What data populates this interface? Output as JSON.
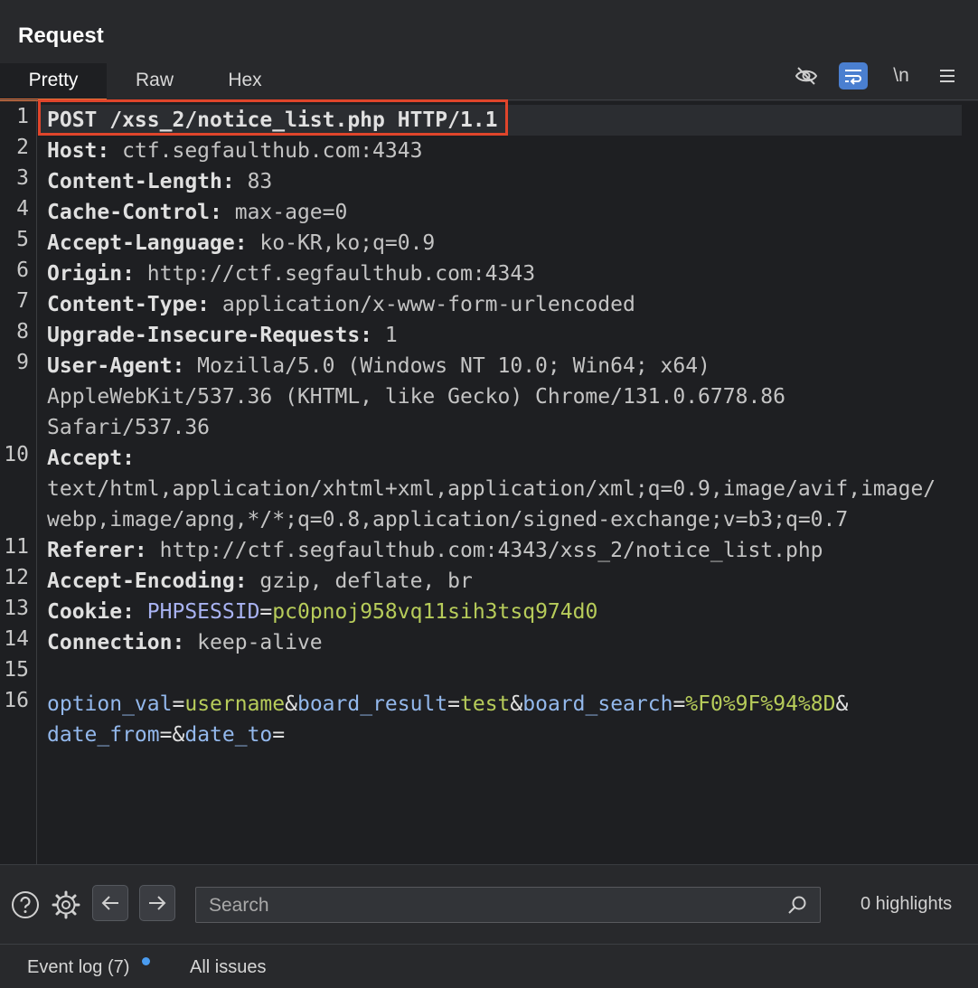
{
  "panel": {
    "title": "Request"
  },
  "tabs": [
    {
      "label": "Pretty",
      "active": true
    },
    {
      "label": "Raw",
      "active": false
    },
    {
      "label": "Hex",
      "active": false
    }
  ],
  "toolbar": {
    "icons": [
      "eye-slash-icon",
      "wrap-lines-icon",
      "newline-icon",
      "menu-icon"
    ],
    "newline_label": "\\n"
  },
  "editor": {
    "line_numbers": [
      "1",
      "2",
      "3",
      "4",
      "5",
      "6",
      "7",
      "8",
      "9",
      "10",
      "11",
      "12",
      "13",
      "14",
      "15",
      "16"
    ],
    "request_line": "POST /xss_2/notice_list.php HTTP/1.1",
    "headers": [
      {
        "name": "Host:",
        "value": " ctf.segfaulthub.com:4343"
      },
      {
        "name": "Content-Length:",
        "value": " 83"
      },
      {
        "name": "Cache-Control:",
        "value": " max-age=0"
      },
      {
        "name": "Accept-Language:",
        "value": " ko-KR,ko;q=0.9"
      },
      {
        "name": "Origin:",
        "value": " http://ctf.segfaulthub.com:4343"
      },
      {
        "name": "Content-Type:",
        "value": " application/x-www-form-urlencoded"
      },
      {
        "name": "Upgrade-Insecure-Requests:",
        "value": " 1"
      },
      {
        "name": "User-Agent:",
        "value": " Mozilla/5.0 (Windows NT 10.0; Win64; x64)"
      },
      {
        "name": "Accept:",
        "value": ""
      },
      {
        "name": "Referer:",
        "value": " http://ctf.segfaulthub.com:4343/xss_2/notice_list.php"
      },
      {
        "name": "Accept-Encoding:",
        "value": " gzip, deflate, br"
      },
      {
        "name": "Connection:",
        "value": " keep-alive"
      }
    ],
    "user_agent_cont": [
      "AppleWebKit/537.36 (KHTML, like Gecko) Chrome/131.0.6778.86",
      "Safari/537.36"
    ],
    "accept_cont": [
      "text/html,application/xhtml+xml,application/xml;q=0.9,image/avif,image/",
      "webp,image/apng,*/*;q=0.8,application/signed-exchange;v=b3;q=0.7"
    ],
    "cookie": {
      "name": "Cookie:",
      "key": "PHPSESSID",
      "eq": "=",
      "value": "pc0pnoj958vq11sih3tsq974d0"
    },
    "body": {
      "p1_key": "option_val",
      "p1_val": "username",
      "p2_key": "board_result",
      "p2_val": "test",
      "p3_key": "board_search",
      "p3_val": "%F0%9F%94%8D",
      "p4_key": "date_from",
      "p5_key": "date_to",
      "eq": "=",
      "amp": "&"
    }
  },
  "search": {
    "placeholder": "Search",
    "value": ""
  },
  "highlights": "0 highlights",
  "status": {
    "event_log": "Event log (7)",
    "all_issues": "All issues"
  },
  "colors": {
    "accent": "#e8743b",
    "highlight_box": "#e0452b",
    "param_value": "#b7cc5a",
    "param_key": "#93b8ec",
    "notification": "#4a9cf0"
  }
}
